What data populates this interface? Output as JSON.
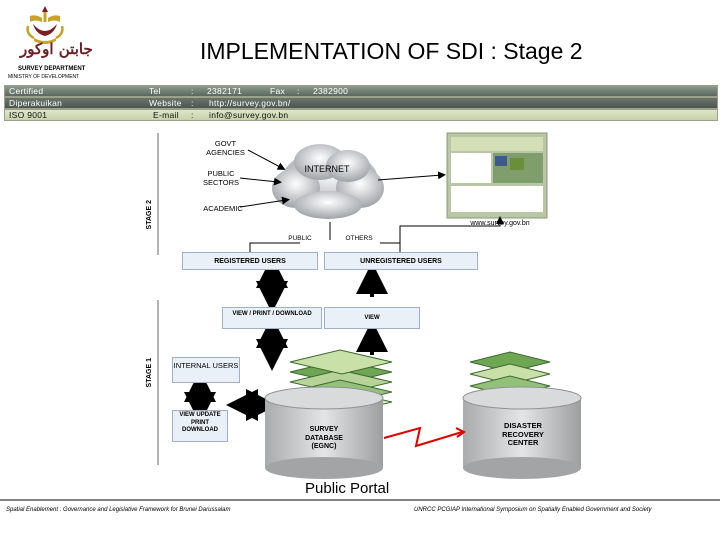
{
  "header": {
    "jawi": "جابتن اوكور",
    "department": "SURVEY DEPARTMENT",
    "ministry": "MINISTRY OF DEVELOPMENT",
    "title": "IMPLEMENTATION OF SDI : Stage 2"
  },
  "info_bars": {
    "row1": {
      "label": "Certified",
      "key": "Tel",
      "sep": ":",
      "value": "2382171",
      "key2": "Fax",
      "sep2": ":",
      "value2": "2382900"
    },
    "row2": {
      "label": "Diperakuikan",
      "key": "Website",
      "sep": ":",
      "value": "http://survey.gov.bn/"
    },
    "row3": {
      "label": "ISO 9001",
      "key": "E-mail",
      "sep": ":",
      "value": "info@survey.gov.bn"
    }
  },
  "diagram": {
    "stage2_label": "STAGE 2",
    "stage1_label": "STAGE 1",
    "govt": "GOVT AGENCIES",
    "public_sectors": "PUBLIC SECTORS",
    "academic": "ACADEMIC",
    "internet": "INTERNET",
    "website": "www.survey.gov.bn",
    "public": "PUBLIC",
    "others": "OTHERS",
    "registered": "REGISTERED USERS",
    "unregistered": "UNREGISTERED USERS",
    "view_print_download": "VIEW / PRINT / DOWNLOAD",
    "view": "VIEW",
    "internal_users": "INTERNAL USERS",
    "view_update": "VIEW UPDATE PRINT DOWNLOAD",
    "survey_db": "SURVEY DATABASE (EGNC)",
    "disaster": "DISASTER RECOVERY CENTER"
  },
  "portal_label": "Public Portal",
  "footer": {
    "left": "Spatial Enablement : Governance and Legislative Framework for Brunei Darussalam",
    "right": "UNRCC PCGIAP International Symposium on Spatially Enabled Government and Society"
  },
  "colors": {
    "crest": "#c9a227",
    "crest_dark": "#7a1f23",
    "bar_dark": "#5a685e",
    "bar_light": "#d6deb9",
    "arrow": "#000000",
    "red_link": "#e00000"
  }
}
